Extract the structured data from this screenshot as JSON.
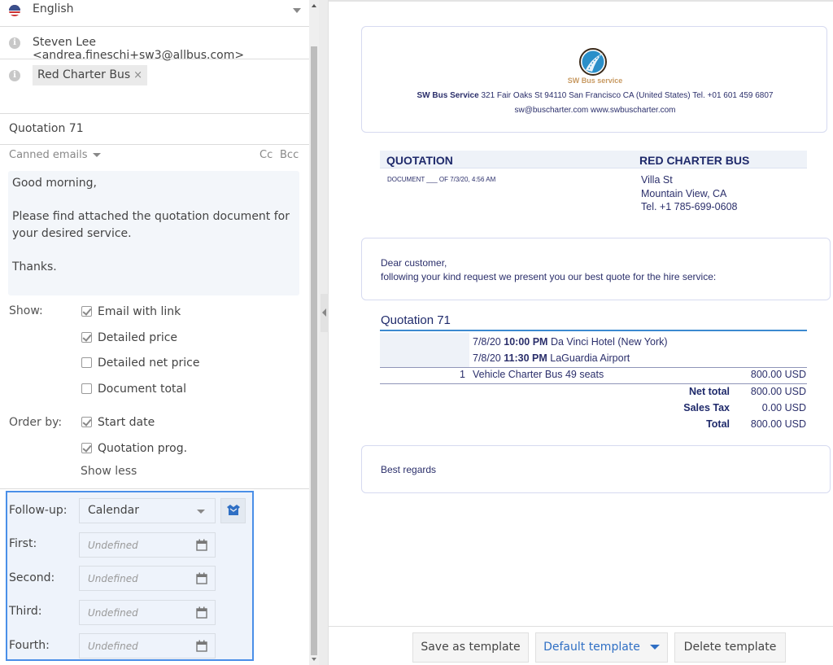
{
  "composer": {
    "language": {
      "icon": "us-flag-icon",
      "value": "English"
    },
    "to": {
      "icon": "info-icon",
      "value": "Steven Lee <andrea.fineschi+sw3@allbus.com>"
    },
    "recipients": {
      "icon": "info-icon",
      "tags": [
        {
          "label": "Red Charter Bus",
          "remove_icon": "×"
        }
      ]
    },
    "subject": "Quotation 71",
    "canned_emails_label": "Canned emails",
    "cc_label": "Cc",
    "bcc_label": "Bcc",
    "body": "Good morning,\n\nPlease find attached the quotation document for your desired service.\n\nThanks.",
    "show": {
      "label": "Show:",
      "options": [
        {
          "label": "Email with link",
          "checked": true
        },
        {
          "label": "Detailed price",
          "checked": true
        },
        {
          "label": "Detailed net price",
          "checked": false
        },
        {
          "label": "Document total",
          "checked": false
        }
      ]
    },
    "order_by": {
      "label": "Order by:",
      "options": [
        {
          "label": "Start date",
          "checked": true
        },
        {
          "label": "Quotation prog.",
          "checked": true
        }
      ]
    },
    "show_less_label": "Show less",
    "followup": {
      "label": "Follow-up:",
      "selected": "Calendar",
      "button_icon": "open-box-icon",
      "dates": [
        {
          "label": "First:",
          "placeholder": "Undefined"
        },
        {
          "label": "Second:",
          "placeholder": "Undefined"
        },
        {
          "label": "Third:",
          "placeholder": "Undefined"
        },
        {
          "label": "Fourth:",
          "placeholder": "Undefined"
        }
      ]
    }
  },
  "document": {
    "company": {
      "logo_text": "SW Bus service",
      "name": "SW Bus Service",
      "address": "321 Fair Oaks St 94110 San Francisco CA (United States) Tel. +01 601 459 6807",
      "contacts": "sw@buscharter.com www.swbuscharter.com"
    },
    "doc_type": "QUOTATION",
    "doc_meta": "DOCUMENT ___ OF 7/3/20, 4:56 AM",
    "client": {
      "name": "RED CHARTER BUS",
      "street": "Villa St",
      "city": "Mountain View, CA",
      "phone": "Tel. +1 785-699-0608"
    },
    "greeting": "Dear customer,",
    "intro": "following your kind request we present you our best quote for the hire service:",
    "quote_title": "Quotation 71",
    "stops": [
      {
        "date": "7/8/20",
        "time": "10:00 PM",
        "place": "Da Vinci Hotel (New York)"
      },
      {
        "date": "7/8/20",
        "time": "11:30 PM",
        "place": "LaGuardia Airport"
      }
    ],
    "items": [
      {
        "qty": "1",
        "description": "Vehicle Charter Bus 49 seats",
        "amount": "800.00 USD"
      }
    ],
    "totals": [
      {
        "label": "Net total",
        "value": "800.00 USD"
      },
      {
        "label": "Sales Tax",
        "value": "0.00 USD"
      },
      {
        "label": "Total",
        "value": "800.00 USD"
      }
    ],
    "closing": "Best regards"
  },
  "toolbar": {
    "save_template": "Save as template",
    "default_template": "Default template",
    "delete_template": "Delete template"
  },
  "colors": {
    "accent": "#4a8fe8",
    "link_blue": "#2f6fc4",
    "doc_text": "#2b2f6b",
    "quote_rule": "#3c8ad0"
  }
}
